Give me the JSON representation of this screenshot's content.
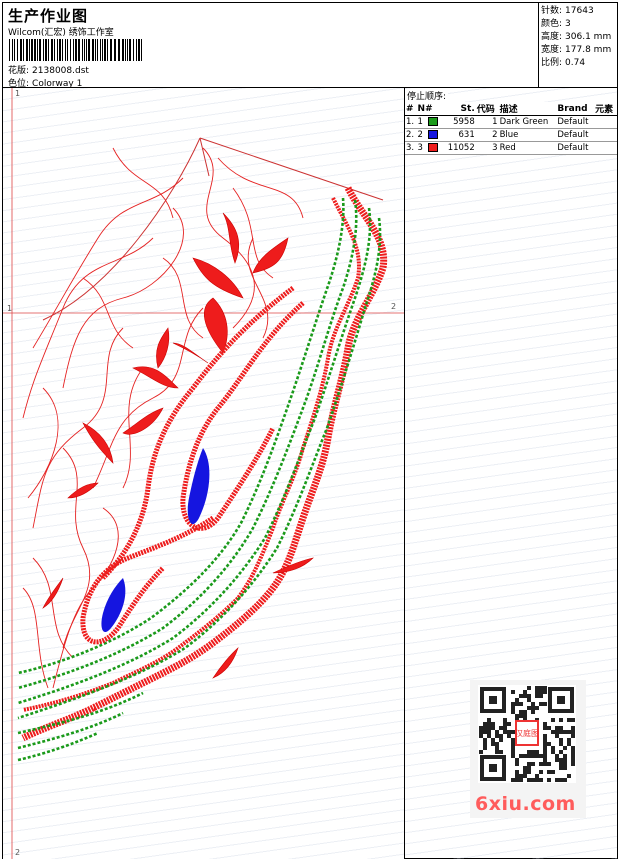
{
  "header": {
    "title": "生产作业图",
    "company": "Wilcom(汇宏) 绣饰工作室",
    "design_label": "花版:",
    "design_value": "2138008.dst",
    "colorway_label": "色位:",
    "colorway_value": "Colorway 1"
  },
  "stats": [
    {
      "label": "针数:",
      "value": "17643"
    },
    {
      "label": "颜色:",
      "value": "3"
    },
    {
      "label": "高度:",
      "value": "306.1 mm"
    },
    {
      "label": "宽度:",
      "value": "177.8 mm"
    },
    {
      "label": "比例:",
      "value": "0.74"
    }
  ],
  "stop_sequence": {
    "title": "停止顺序:",
    "columns": [
      "#",
      "N#",
      "St.",
      "代码",
      "描述",
      "Brand",
      "元素"
    ],
    "rows": [
      {
        "num": "1.",
        "n": "1",
        "stitches": "5958",
        "code": "1",
        "desc": "Dark Green",
        "brand": "Default",
        "color": "#1a9a1a"
      },
      {
        "num": "2.",
        "n": "2",
        "stitches": "631",
        "code": "2",
        "desc": "Blue",
        "brand": "Default",
        "color": "#1515e0"
      },
      {
        "num": "3.",
        "n": "3",
        "stitches": "11052",
        "code": "3",
        "desc": "Red",
        "brand": "Default",
        "color": "#ee1c1c"
      }
    ]
  },
  "canvas": {
    "marker_top_left": "1",
    "marker_mid_left": "1",
    "marker_mid_right": "2",
    "marker_bottom_left": "2",
    "thread_colors": {
      "green": "#1a9a1a",
      "blue": "#1515e0",
      "red": "#ee1c1c"
    }
  },
  "watermark": "6xiu.com",
  "qr_stamp": "汉庭图"
}
